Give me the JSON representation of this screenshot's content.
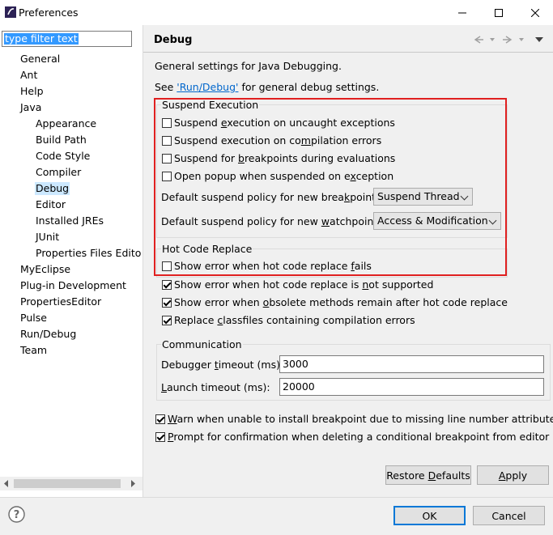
{
  "window": {
    "title": "Preferences",
    "icon": "eclipse-icon"
  },
  "filter": {
    "value": "type filter text"
  },
  "tree": [
    {
      "label": "General",
      "indent": 0
    },
    {
      "label": "Ant",
      "indent": 0
    },
    {
      "label": "Help",
      "indent": 0
    },
    {
      "label": "Java",
      "indent": 0
    },
    {
      "label": "Appearance",
      "indent": 1
    },
    {
      "label": "Build Path",
      "indent": 1
    },
    {
      "label": "Code Style",
      "indent": 1
    },
    {
      "label": "Compiler",
      "indent": 1
    },
    {
      "label": "Debug",
      "indent": 1,
      "selected": true
    },
    {
      "label": "Editor",
      "indent": 1
    },
    {
      "label": "Installed JREs",
      "indent": 1
    },
    {
      "label": "JUnit",
      "indent": 1
    },
    {
      "label": "Properties Files Edito",
      "indent": 1
    },
    {
      "label": "MyEclipse",
      "indent": 0
    },
    {
      "label": "Plug-in Development",
      "indent": 0
    },
    {
      "label": "PropertiesEditor",
      "indent": 0
    },
    {
      "label": "Pulse",
      "indent": 0
    },
    {
      "label": "Run/Debug",
      "indent": 0
    },
    {
      "label": "Team",
      "indent": 0
    }
  ],
  "page": {
    "title": "Debug",
    "intro": "General settings for Java Debugging.",
    "see_prefix": "See ",
    "see_link": "'Run/Debug'",
    "see_suffix": " for general debug settings."
  },
  "suspend": {
    "title": "Suspend Execution",
    "options": [
      {
        "label": "Suspend execution on uncaught exceptions",
        "checked": false
      },
      {
        "label": "Suspend execution on compilation errors",
        "checked": false
      },
      {
        "label": "Suspend for breakpoints during evaluations",
        "checked": false
      },
      {
        "label": "Open popup when suspended on exception",
        "checked": false
      }
    ],
    "bp_policy_label": "Default suspend policy for new breakpoints:",
    "bp_policy_value": "Suspend Thread",
    "wp_policy_label": "Default suspend policy for new watchpoints:",
    "wp_policy_value": "Access & Modification"
  },
  "hcr": {
    "title": "Hot Code Replace",
    "options": [
      {
        "label": "Show error when hot code replace fails",
        "checked": false
      },
      {
        "label": "Show error when hot code replace is not supported",
        "checked": true
      },
      {
        "label": "Show error when obsolete methods remain after hot code replace",
        "checked": true
      },
      {
        "label": "Replace classfiles containing compilation errors",
        "checked": true
      }
    ]
  },
  "comm": {
    "title": "Communication",
    "timeout_label": "Debugger timeout (ms):",
    "timeout_value": "3000",
    "launch_label": "Launch timeout (ms):",
    "launch_value": "20000"
  },
  "misc": [
    {
      "label": "Warn when unable to install breakpoint due to missing line number attributes",
      "checked": true
    },
    {
      "label": "Prompt for confirmation when deleting a conditional breakpoint from editor",
      "checked": true
    }
  ],
  "buttons": {
    "restore": "Restore Defaults",
    "apply": "Apply",
    "ok": "OK",
    "cancel": "Cancel"
  },
  "colors": {
    "accent": "#0078d7",
    "highlight": "#e02020",
    "selection": "#cce8ff",
    "link": "#0066cc"
  }
}
